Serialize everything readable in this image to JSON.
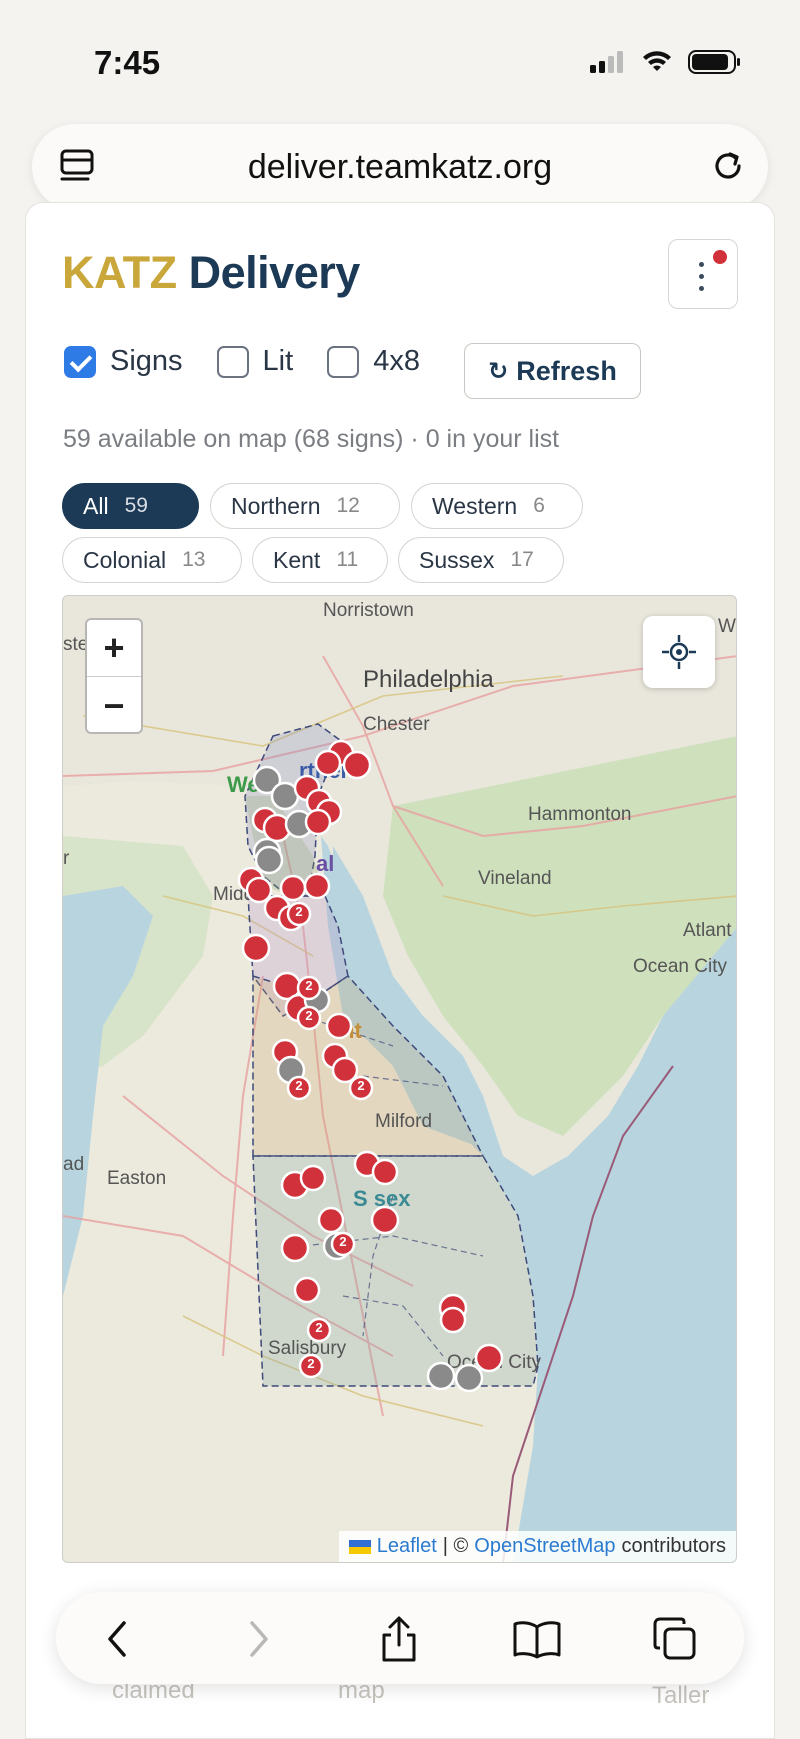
{
  "status": {
    "time": "7:45"
  },
  "browser": {
    "url": "deliver.teamkatz.org"
  },
  "app": {
    "brand_katz": "KATZ",
    "brand_delivery": "Delivery",
    "accent": "#c9a73a",
    "primary": "#1c3a56"
  },
  "filters": {
    "signs_label": "Signs",
    "signs_checked": true,
    "lit_label": "Lit",
    "lit_checked": false,
    "x48_label": "4x8",
    "x48_checked": false,
    "refresh_label": "Refresh"
  },
  "summary": "59 available on map (68 signs) · 0 in your list",
  "regions": [
    {
      "label": "All",
      "count": "59",
      "active": true
    },
    {
      "label": "Northern",
      "count": "12",
      "active": false
    },
    {
      "label": "Western",
      "count": "6",
      "active": false
    },
    {
      "label": "Colonial",
      "count": "13",
      "active": false
    },
    {
      "label": "Kent",
      "count": "11",
      "active": false
    },
    {
      "label": "Sussex",
      "count": "17",
      "active": false
    }
  ],
  "map": {
    "places": {
      "norristown": "Norristown",
      "philadelphia": "Philadelphia",
      "chester": "Chester",
      "hammonton": "Hammonton",
      "vineland": "Vineland",
      "atlant": "Atlant",
      "ocean_city_nj": "Ocean City",
      "midd": "Midd",
      "milford": "Milford",
      "easton": "Easton",
      "salisbury": "Salisbury",
      "ocean_city_md": "Ocean City",
      "ste": "ste",
      "w": "W",
      "ad": "ad",
      "r": "r"
    },
    "region_labels": {
      "northern": "rthern",
      "western": "We",
      "colonial": "al",
      "kent": "nt",
      "sussex": "S  sex"
    },
    "marker_colors": {
      "available": "#d0313a",
      "claimed": "#8a8a8a"
    },
    "cluster_label": "2",
    "zoom_in": "+",
    "zoom_out": "−",
    "attribution_leaflet": "Leaflet",
    "attribution_sep": "| ©",
    "attribution_osm": "OpenStreetMap",
    "attribution_tail": "contributors"
  },
  "peek": {
    "col1": "claimed",
    "col2": "map",
    "col3": "Taller"
  }
}
